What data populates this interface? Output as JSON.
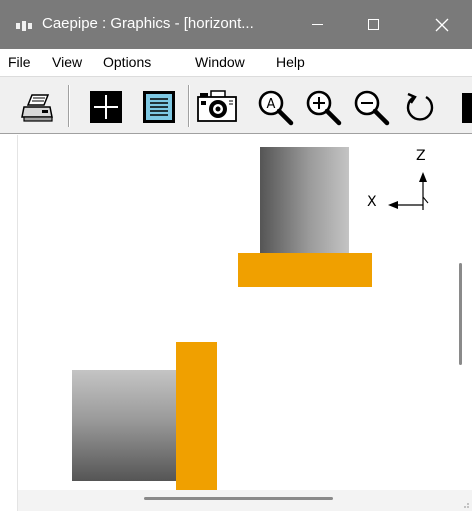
{
  "window": {
    "title": "Caepipe : Graphics -  [horizont...",
    "controls": {
      "minimize": "—",
      "maximize": "☐",
      "close": "✕"
    }
  },
  "menubar": {
    "items": [
      "File",
      "View",
      "Options",
      "Window",
      "Help"
    ]
  },
  "toolbar": {
    "tools": [
      "print-icon",
      "crosshair-icon",
      "document-list-icon",
      "camera-icon",
      "zoom-area-icon",
      "zoom-in-icon",
      "zoom-out-icon",
      "rotate-icon"
    ]
  },
  "canvas": {
    "axes": {
      "vertical": "Z",
      "horizontal": "X"
    },
    "colors": {
      "support": "#f0a000",
      "pipe_dark": "#5a5a5a",
      "pipe_light": "#bdbdbd"
    }
  }
}
